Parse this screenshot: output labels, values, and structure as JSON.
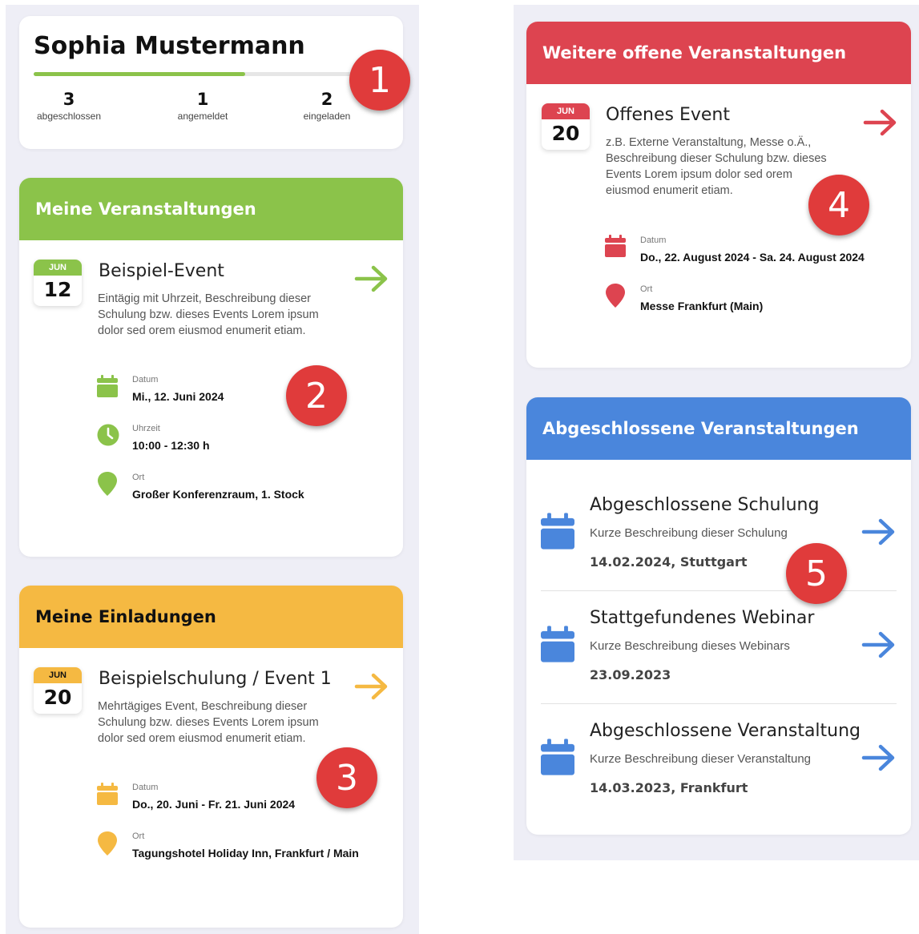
{
  "colors": {
    "green": "#8bc34a",
    "yellow": "#f5b942",
    "red": "#dd4450",
    "blue": "#4a86dc",
    "badge": "#e03b3b"
  },
  "profile": {
    "name": "Sophia Mustermann",
    "progress_fraction": 0.6,
    "stats": [
      {
        "value": "3",
        "label": "abgeschlossen"
      },
      {
        "value": "1",
        "label": "angemeldet"
      },
      {
        "value": "2",
        "label": "eingeladen"
      }
    ]
  },
  "badges": [
    "1",
    "2",
    "3",
    "4",
    "5"
  ],
  "my_events": {
    "title": "Meine Veranstaltungen",
    "event": {
      "month": "JUN",
      "day": "12",
      "title": "Beispiel-Event",
      "description_lines": [
        "Eintägig mit Uhrzeit, Beschreibung dieser",
        "Schulung bzw. dieses Events Lorem ipsum",
        "dolor sed orem eiusmod enumerit etiam."
      ],
      "date_label": "Datum",
      "date_value": "Mi., 12. Juni 2024",
      "time_label": "Uhrzeit",
      "time_value": "10:00 - 12:30 h",
      "place_label": "Ort",
      "place_value": "Großer Konferenzraum, 1. Stock"
    }
  },
  "invitations": {
    "title": "Meine Einladungen",
    "event": {
      "month": "JUN",
      "day": "20",
      "title": "Beispielschulung / Event 1",
      "description_lines": [
        "Mehrtägiges Event, Beschreibung dieser",
        "Schulung bzw. dieses Events Lorem ipsum",
        "dolor sed orem eiusmod enumerit etiam."
      ],
      "date_label": "Datum",
      "date_value": "Do., 20. Juni - Fr. 21. Juni 2024",
      "place_label": "Ort",
      "place_value": "Tagungshotel Holiday Inn, Frankfurt / Main"
    }
  },
  "open_events": {
    "title": "Weitere offene Veranstaltungen",
    "event": {
      "month": "JUN",
      "day": "20",
      "title": "Offenes Event",
      "description_lines": [
        "z.B. Externe Veranstaltung, Messe o.Ä.,",
        "Beschreibung dieser Schulung bzw. dieses",
        "Events Lorem ipsum dolor sed orem",
        "eiusmod enumerit etiam."
      ],
      "date_label": "Datum",
      "date_value": "Do., 22. August 2024 - Sa. 24. August 2024",
      "place_label": "Ort",
      "place_value": "Messe Frankfurt (Main)"
    }
  },
  "completed": {
    "title": "Abgeschlossene Veranstaltungen",
    "items": [
      {
        "title": "Abgeschlossene Schulung",
        "description": "Kurze Beschreibung dieser Schulung",
        "meta": "14.02.2024, Stuttgart"
      },
      {
        "title": "Stattgefundenes Webinar",
        "description": "Kurze Beschreibung dieses Webinars",
        "meta": "23.09.2023"
      },
      {
        "title": "Abgeschlossene Veranstaltung",
        "description": "Kurze Beschreibung dieser Veranstaltung",
        "meta": "14.03.2023, Frankfurt"
      }
    ]
  }
}
